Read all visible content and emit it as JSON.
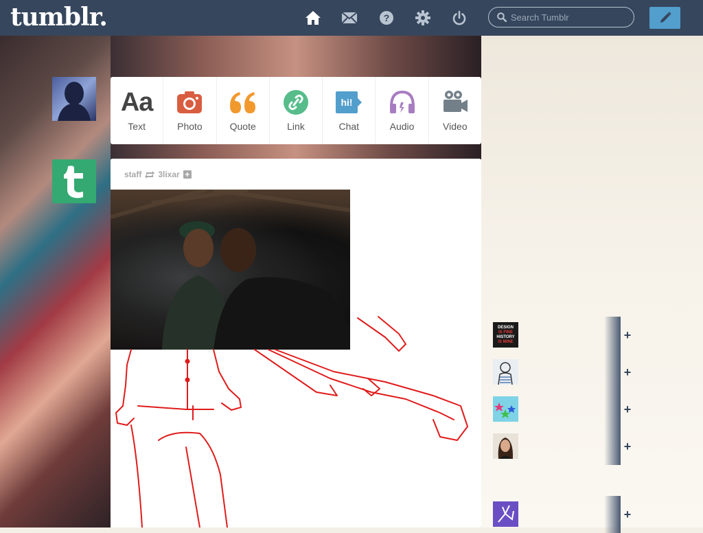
{
  "header": {
    "logo": "tumblr.",
    "search_placeholder": "Search Tumblr",
    "nav": [
      "home-icon",
      "mail-icon",
      "help-icon",
      "gear-icon",
      "power-icon"
    ]
  },
  "post_types": [
    {
      "label": "Text",
      "icon": "text-icon",
      "color": "#444444"
    },
    {
      "label": "Photo",
      "icon": "camera-icon",
      "color": "#d95e40"
    },
    {
      "label": "Quote",
      "icon": "quote-icon",
      "color": "#f2992e"
    },
    {
      "label": "Link",
      "icon": "link-icon",
      "color": "#56bc8a"
    },
    {
      "label": "Chat",
      "icon": "chat-icon",
      "color": "#529ecc"
    },
    {
      "label": "Audio",
      "icon": "headphones-icon",
      "color": "#a77dc2"
    },
    {
      "label": "Video",
      "icon": "video-icon",
      "color": "#748089"
    }
  ],
  "post": {
    "author": "staff",
    "reblogged_from": "3lixar"
  },
  "recommended": [
    {
      "avatar_text": [
        "DESIGN",
        "IS FINE",
        "HISTORY",
        "IS MINE"
      ],
      "avatar_color": "#1a1a1a"
    },
    {
      "avatar_text": [],
      "avatar_color": "#e9eef3"
    },
    {
      "avatar_text": [],
      "avatar_color": "#7fd3e6"
    },
    {
      "avatar_text": [],
      "avatar_color": "#c9a88a"
    },
    {
      "avatar_text": [],
      "avatar_color": "#6a4fc4"
    }
  ]
}
